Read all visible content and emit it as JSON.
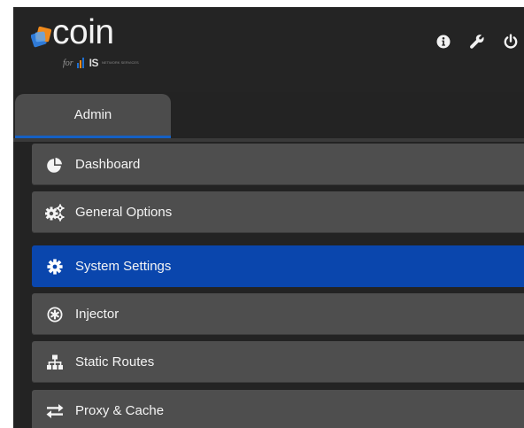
{
  "app": {
    "logo_word": "coin",
    "logo_for": "for",
    "logo_brand": "IS",
    "logo_tag": "NETWORK SERVICES"
  },
  "toolbar": {
    "icons": [
      "info-icon",
      "wrench-icon",
      "power-icon"
    ]
  },
  "tabs": [
    {
      "label": "Admin",
      "active": true
    }
  ],
  "menu": {
    "items": [
      {
        "label": "Dashboard",
        "icon": "pie-chart-icon"
      },
      {
        "label": "General Options",
        "icon": "gears-icon"
      },
      {
        "label": "System Settings",
        "icon": "gear-icon",
        "active": true
      },
      {
        "label": "Injector",
        "icon": "asterisk-circle-icon"
      },
      {
        "label": "Static Routes",
        "icon": "sitemap-icon"
      },
      {
        "label": "Proxy & Cache",
        "icon": "exchange-icon"
      }
    ]
  },
  "colors": {
    "background": "#232323",
    "item": "#4e4e4e",
    "active": "#0a46ad",
    "tab_underline": "#1560c4",
    "logo_orange": "#f08a1c",
    "logo_blue": "#1f6fd0"
  }
}
